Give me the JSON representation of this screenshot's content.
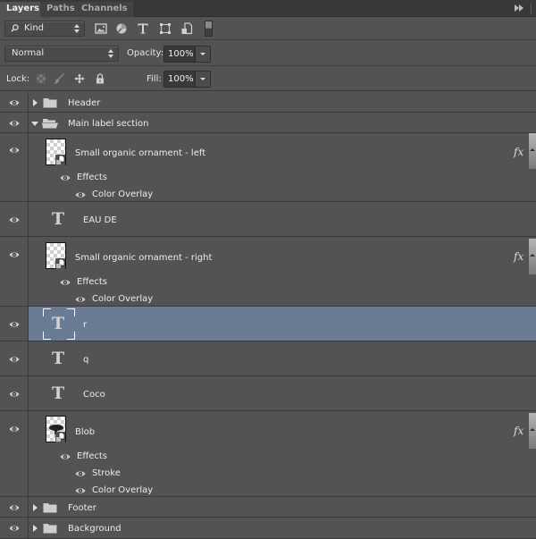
{
  "tabs": [
    {
      "label": "Layers",
      "active": true
    },
    {
      "label": "Paths",
      "active": false
    },
    {
      "label": "Channels",
      "active": false
    }
  ],
  "panel_menu_icon": "double-chevron-right-icon",
  "filter": {
    "kind_label": "Kind",
    "filter_buttons": [
      "pixel-layer-filter-icon",
      "adjustment-layer-filter-icon",
      "type-layer-filter-icon",
      "shape-layer-filter-icon",
      "smart-object-filter-icon"
    ]
  },
  "blend": {
    "mode": "Normal",
    "opacity_label": "Opacity:",
    "opacity_value": "100%"
  },
  "lock": {
    "label": "Lock:",
    "icons": [
      "lock-transparent-pixels-icon",
      "lock-image-pixels-icon",
      "lock-position-icon",
      "lock-all-icon"
    ],
    "fill_label": "Fill:",
    "fill_value": "100%"
  },
  "layers": [
    {
      "name": "Header",
      "type": "group",
      "expanded": false,
      "visible": true
    },
    {
      "name": "Main label section",
      "type": "group",
      "expanded": true,
      "visible": true
    },
    {
      "name": "Small organic ornament - left",
      "type": "smart-object",
      "visible": true,
      "fx": true,
      "effects_label": "Effects",
      "effects": [
        "Color Overlay"
      ]
    },
    {
      "name": "EAU DE",
      "type": "text",
      "visible": true
    },
    {
      "name": "Small organic ornament - right",
      "type": "smart-object",
      "visible": true,
      "fx": true,
      "effects_label": "Effects",
      "effects": [
        "Color Overlay"
      ]
    },
    {
      "name": "r",
      "type": "text",
      "visible": true,
      "selected": true
    },
    {
      "name": "q",
      "type": "text",
      "visible": true
    },
    {
      "name": "Coco",
      "type": "text",
      "visible": true
    },
    {
      "name": "Blob",
      "type": "smart-object",
      "visible": true,
      "fx": true,
      "effects_label": "Effects",
      "effects": [
        "Stroke",
        "Color Overlay"
      ]
    },
    {
      "name": "Footer",
      "type": "group",
      "expanded": false,
      "visible": true
    },
    {
      "name": "Background",
      "type": "group",
      "expanded": false,
      "visible": true
    }
  ],
  "fx_label": "fx",
  "type_glyph": "T",
  "colors": {
    "panel_bg": "#535353",
    "selected_row": "#6a7c94",
    "tabbar_bg": "#393939"
  }
}
